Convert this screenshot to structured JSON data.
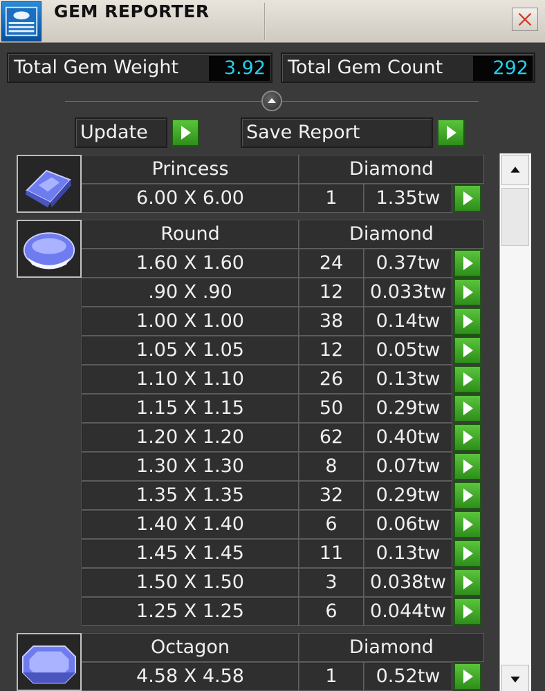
{
  "window": {
    "title": "GEM REPORTER"
  },
  "totals": {
    "weight_label": "Total Gem Weight",
    "weight_value": "3.92",
    "count_label": "Total Gem Count",
    "count_value": "292"
  },
  "actions": {
    "update_label": "Update",
    "save_label": "Save Report"
  },
  "colors": {
    "accent_value": "#22d0f0",
    "play_green": "#3fae28",
    "gem_blue": "#6f7cf0"
  },
  "groups": [
    {
      "shape": "Princess",
      "material": "Diamond",
      "icon": "princess-gem-icon",
      "rows": [
        {
          "size": "6.00 X 6.00",
          "count": "1",
          "weight": "1.35tw"
        }
      ]
    },
    {
      "shape": "Round",
      "material": "Diamond",
      "icon": "round-gem-icon",
      "rows": [
        {
          "size": "1.60 X 1.60",
          "count": "24",
          "weight": "0.37tw"
        },
        {
          "size": ".90 X .90",
          "count": "12",
          "weight": "0.033tw"
        },
        {
          "size": "1.00 X 1.00",
          "count": "38",
          "weight": "0.14tw"
        },
        {
          "size": "1.05 X 1.05",
          "count": "12",
          "weight": "0.05tw"
        },
        {
          "size": "1.10 X 1.10",
          "count": "26",
          "weight": "0.13tw"
        },
        {
          "size": "1.15 X 1.15",
          "count": "50",
          "weight": "0.29tw"
        },
        {
          "size": "1.20 X 1.20",
          "count": "62",
          "weight": "0.40tw"
        },
        {
          "size": "1.30 X 1.30",
          "count": "8",
          "weight": "0.07tw"
        },
        {
          "size": "1.35 X 1.35",
          "count": "32",
          "weight": "0.29tw"
        },
        {
          "size": "1.40 X 1.40",
          "count": "6",
          "weight": "0.06tw"
        },
        {
          "size": "1.45 X 1.45",
          "count": "11",
          "weight": "0.13tw"
        },
        {
          "size": "1.50 X 1.50",
          "count": "3",
          "weight": "0.038tw"
        },
        {
          "size": "1.25 X 1.25",
          "count": "6",
          "weight": "0.044tw"
        }
      ]
    },
    {
      "shape": "Octagon",
      "material": "Diamond",
      "icon": "octagon-gem-icon",
      "rows": [
        {
          "size": "4.58 X 4.58",
          "count": "1",
          "weight": "0.52tw"
        }
      ]
    }
  ]
}
